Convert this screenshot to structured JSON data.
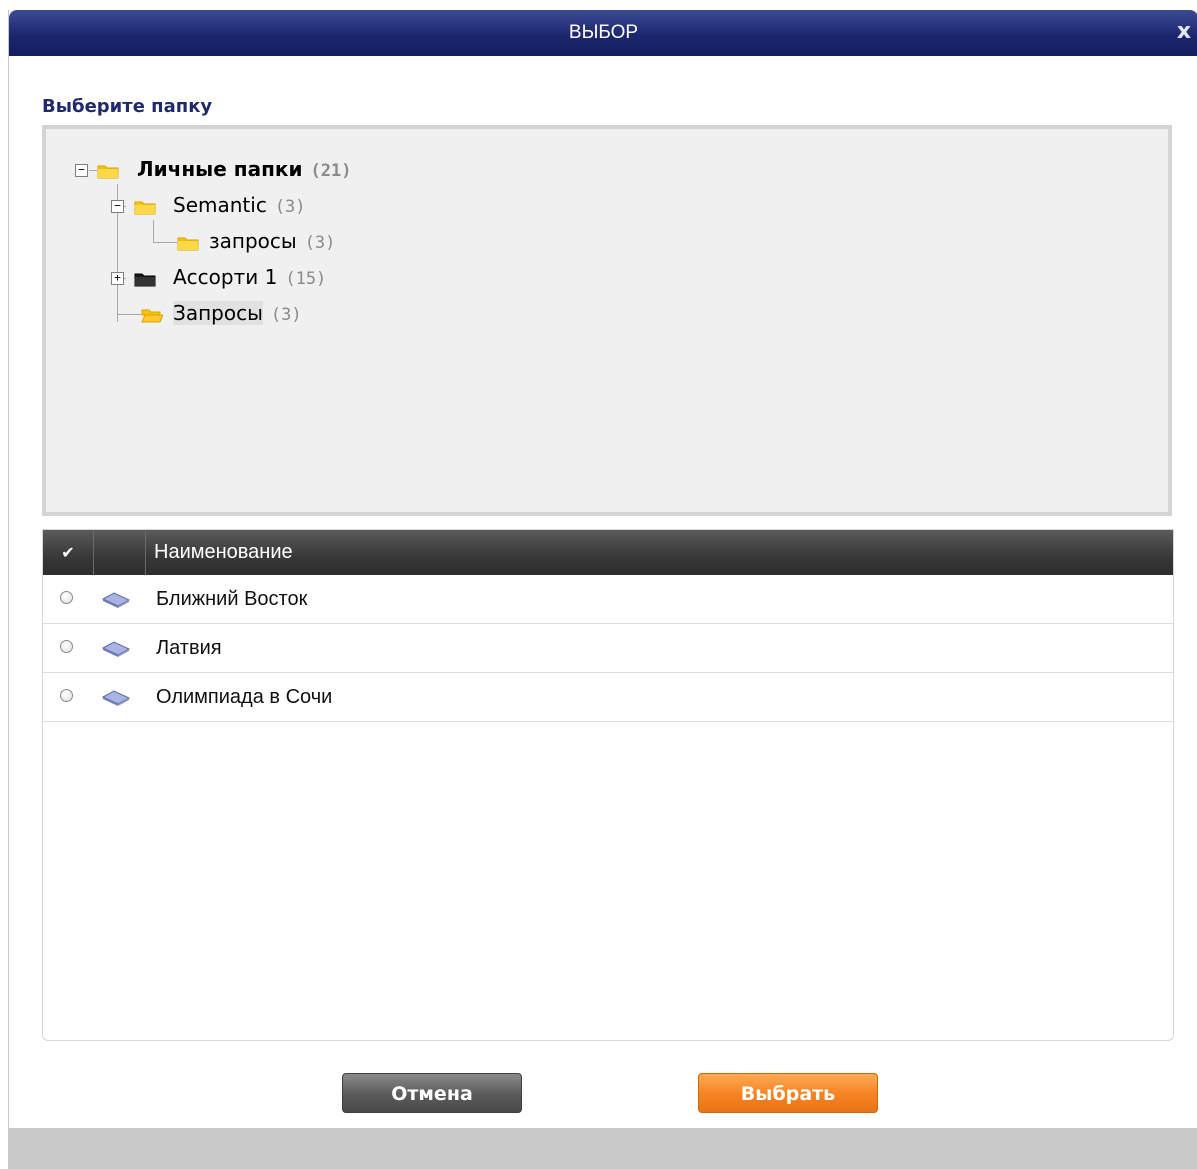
{
  "dialog": {
    "title": "ВЫБОР",
    "close_label": "x"
  },
  "section_title": "Выберите папку",
  "tree": {
    "root": {
      "label": "Личные папки",
      "count": "(21)",
      "toggle": "−"
    },
    "nodes": [
      {
        "label": "Semantic",
        "count": "(3)",
        "toggle": "−"
      },
      {
        "label": "запросы",
        "count": "(3)"
      },
      {
        "label": "Ассорти 1",
        "count": "(15)",
        "toggle": "+"
      },
      {
        "label": "Запросы",
        "count": "(3)"
      }
    ]
  },
  "grid": {
    "header": {
      "check_icon": "✔",
      "name": "Наименование"
    },
    "rows": [
      {
        "name": "Ближний Восток"
      },
      {
        "name": "Латвия"
      },
      {
        "name": "Олимпиада в Сочи"
      }
    ]
  },
  "buttons": {
    "cancel": "Отмена",
    "select": "Выбрать"
  },
  "colors": {
    "titlebar": "#1d2770",
    "section_title": "#1f2a6e",
    "select_button": "#f58220",
    "cancel_button": "#5a5a5a",
    "folder_yellow": "#f5c400"
  },
  "icons": {
    "close": "close-icon",
    "folder": "folder-icon",
    "folder_dark": "folder-dark-icon",
    "folder_open": "folder-open-icon",
    "query": "query-icon",
    "check": "check-icon",
    "radio": "radio-icon"
  }
}
